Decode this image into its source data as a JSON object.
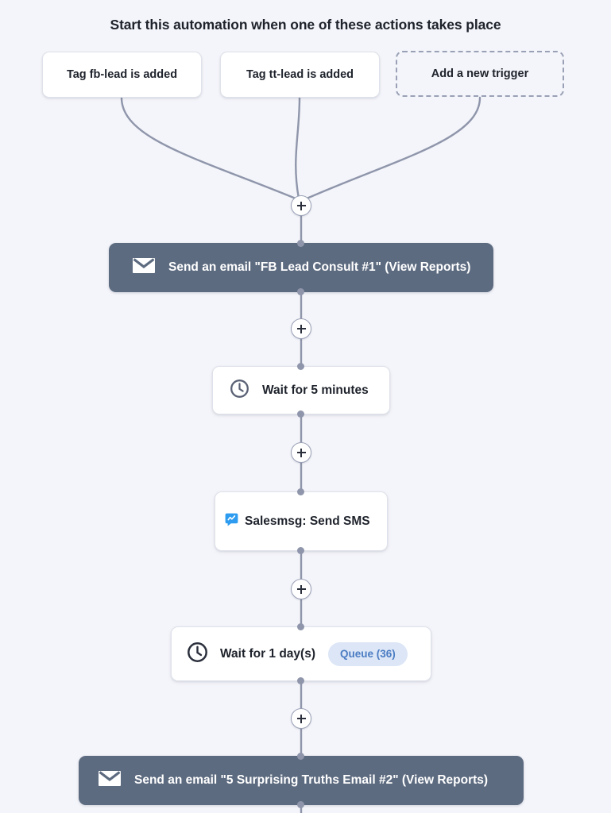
{
  "header": {
    "title": "Start this automation when one of these actions takes place"
  },
  "colors": {
    "page_background": "#f4f5fa",
    "card_background": "#ffffff",
    "card_border": "#dfe2ea",
    "email_bar": "#5d6b80",
    "connector": "#8f96ab",
    "text_dark": "#1e222b",
    "badge_background": "#dce6f6",
    "badge_text": "#4b7cc3",
    "salesmsg_blue": "#2d9cf0"
  },
  "triggers": [
    {
      "label": "Tag fb-lead is added",
      "style": "solid",
      "icon": ""
    },
    {
      "label": "Tag tt-lead is added",
      "style": "solid",
      "icon": ""
    },
    {
      "label": "Add a new trigger",
      "style": "dashed",
      "icon": "plus-placeholder"
    }
  ],
  "steps": [
    {
      "type": "email",
      "icon": "envelope-icon",
      "label": "Send an email \"FB Lead Consult #1\" (View Reports)",
      "badge": null
    },
    {
      "type": "wait",
      "icon": "clock-icon",
      "label": "Wait for 5 minutes",
      "badge": null
    },
    {
      "type": "sms",
      "icon": "salesmsg-icon",
      "label": "Salesmsg: Send SMS",
      "badge": null
    },
    {
      "type": "wait",
      "icon": "clock-icon",
      "label": "Wait for 1 day(s)",
      "badge": "Queue (36)"
    },
    {
      "type": "email",
      "icon": "envelope-icon",
      "label": "Send an email \"5 Surprising Truths Email #2\" (View Reports)",
      "badge": null
    }
  ],
  "add_buttons": [
    {
      "name": "add-step-after-triggers",
      "label": "+"
    },
    {
      "name": "add-step-after-email-1",
      "label": "+"
    },
    {
      "name": "add-step-after-wait-5m",
      "label": "+"
    },
    {
      "name": "add-step-after-sms",
      "label": "+"
    },
    {
      "name": "add-step-after-wait-1d",
      "label": "+"
    }
  ]
}
